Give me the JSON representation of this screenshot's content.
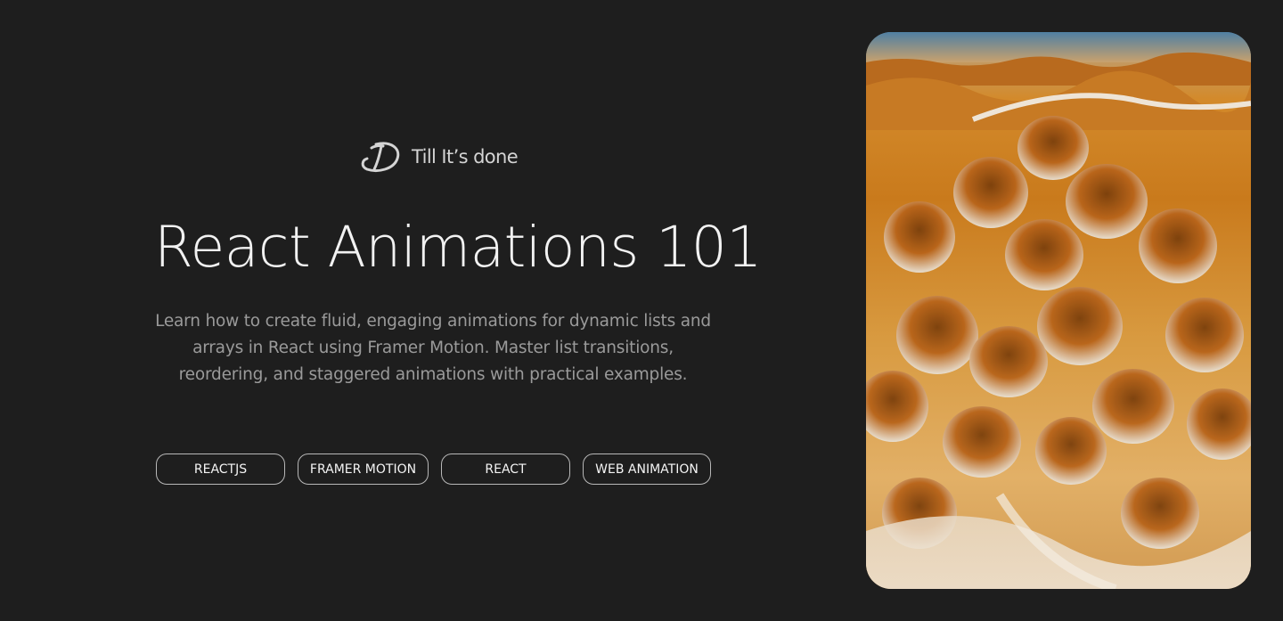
{
  "brand": {
    "logo_icon": "brand-logo-icon",
    "name": "Till It’s done"
  },
  "hero": {
    "title": "React Animations 101",
    "description": "Learn how to create fluid, engaging animations for dynamic lists and arrays in React using Framer Motion. Master list transitions, reordering, and staggered animations with practical examples."
  },
  "tags": [
    "REACTJS",
    "FRAMER MOTION",
    "REACT",
    "WEB ANIMATION"
  ],
  "image": {
    "description_icon": "desert-dunes-image"
  },
  "colors": {
    "background": "#1e1e1e",
    "title": "#f2f2f2",
    "description": "#9a9a9a",
    "tag_border": "#b8b8b8"
  }
}
